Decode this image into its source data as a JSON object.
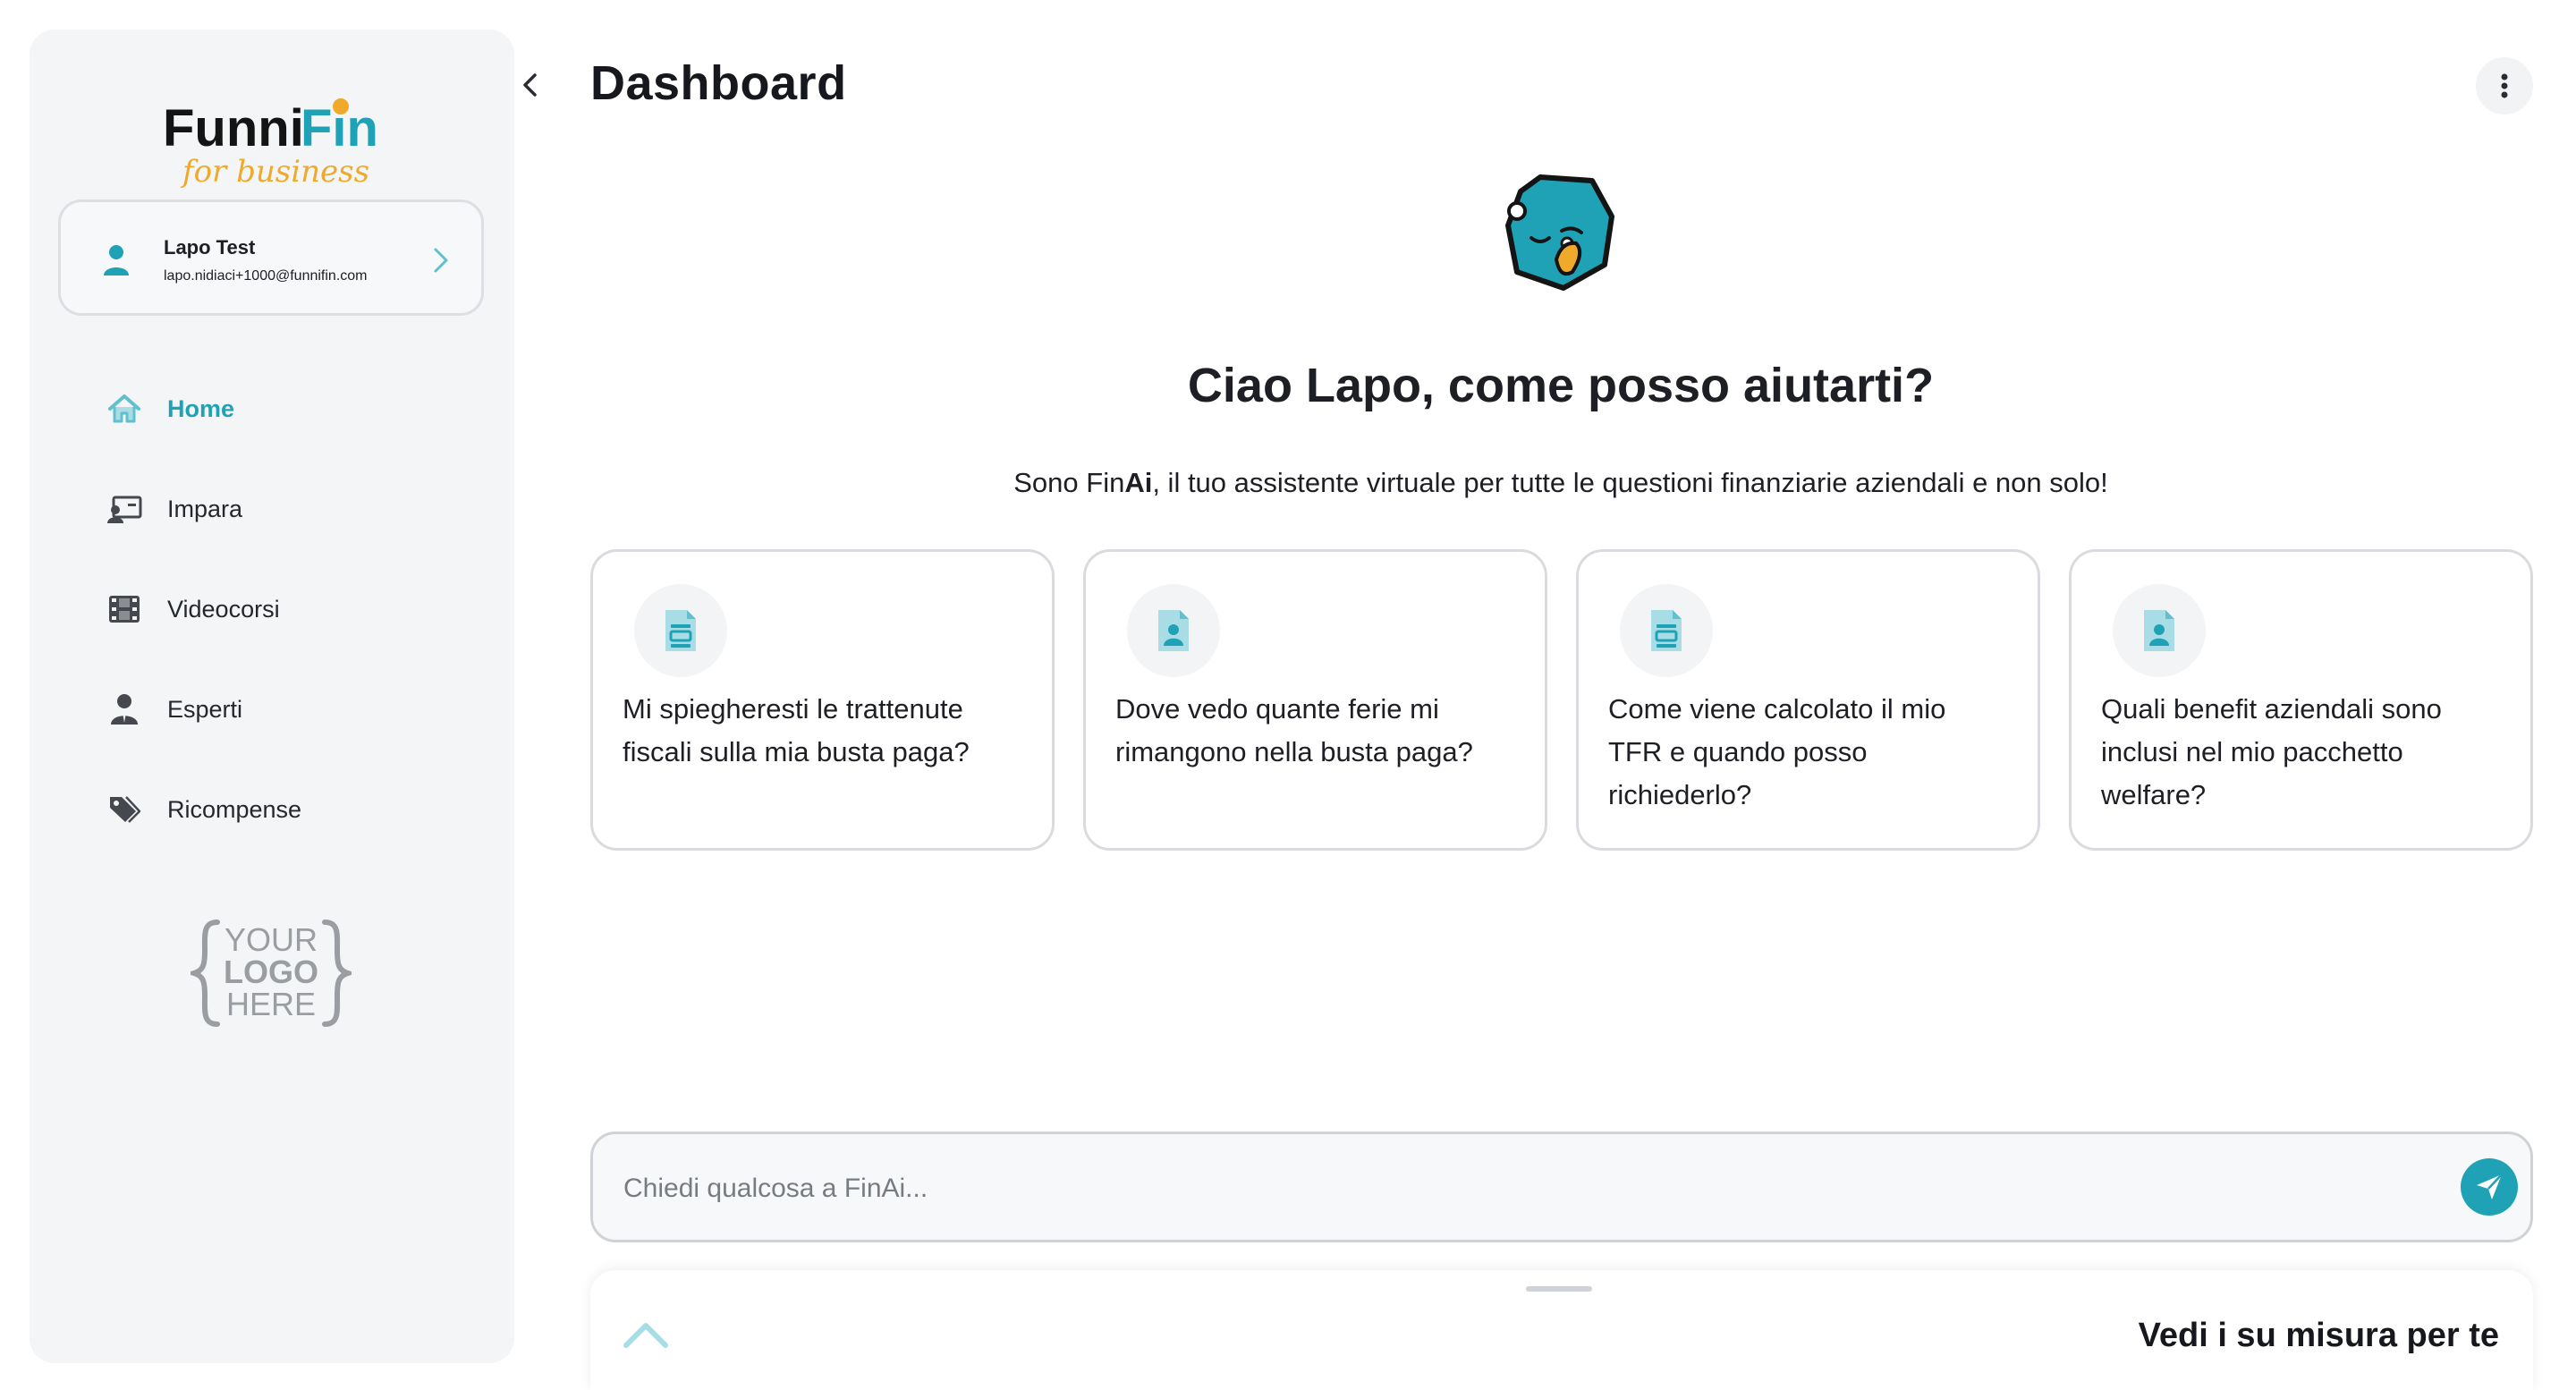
{
  "brand": {
    "name_dark": "Funni",
    "name_light": "Fin",
    "tagline": "for business"
  },
  "user": {
    "name": "Lapo Test",
    "email": "lapo.nidiaci+1000@funnifin.com"
  },
  "nav": {
    "items": [
      {
        "label": "Home",
        "icon": "home-icon",
        "active": true
      },
      {
        "label": "Impara",
        "icon": "learn-icon",
        "active": false
      },
      {
        "label": "Videocorsi",
        "icon": "film-icon",
        "active": false
      },
      {
        "label": "Esperti",
        "icon": "expert-icon",
        "active": false
      },
      {
        "label": "Ricompense",
        "icon": "tags-icon",
        "active": false
      }
    ]
  },
  "company_logo": {
    "line1": "YOUR",
    "line2": "LOGO",
    "line3": "HERE"
  },
  "header": {
    "title": "Dashboard"
  },
  "assistant": {
    "greeting": "Ciao Lapo, come posso aiutarti?",
    "intro_before": "Sono Fin",
    "intro_bold": "Ai",
    "intro_after": ", il tuo assistente virtuale per tutte le questioni finanziarie aziendali e non solo!"
  },
  "suggestions": [
    {
      "text": "Mi spiegheresti le trattenute fiscali sulla mia busta paga?",
      "icon": "document-icon"
    },
    {
      "text": "Dove vedo quante ferie mi rimangono nella busta paga?",
      "icon": "person-document-icon"
    },
    {
      "text": "Come viene calcolato il mio TFR e quando posso richiederlo?",
      "icon": "document-icon"
    },
    {
      "text": "Quali benefit aziendali sono inclusi nel mio pacchetto welfare?",
      "icon": "person-document-icon"
    }
  ],
  "chat": {
    "placeholder": "Chiedi qualcosa a FinAi...",
    "value": ""
  },
  "bottom_sheet": {
    "title": "Vedi i su misura per te"
  },
  "colors": {
    "accent": "#1fa2b6",
    "brand_orange": "#f0a92a",
    "sidebar_bg": "#f4f5f6",
    "text": "#1d1f24"
  }
}
